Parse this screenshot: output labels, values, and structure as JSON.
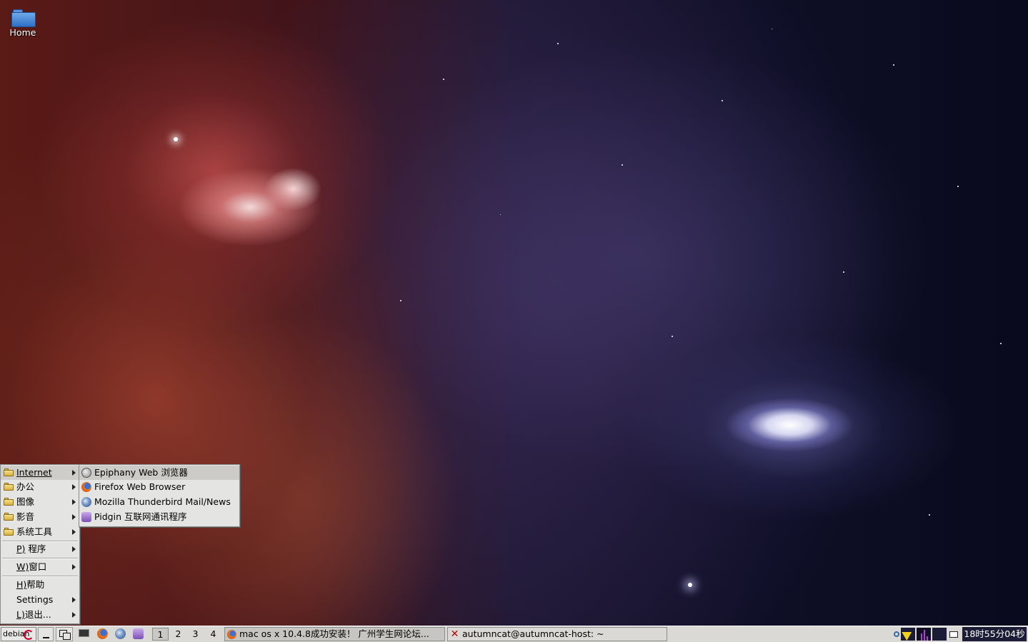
{
  "desktop": {
    "home_label": "Home"
  },
  "main_menu": {
    "items": [
      {
        "label": "Internet",
        "icon": "folder-icon",
        "submenu": true
      },
      {
        "label": "办公",
        "icon": "folder-icon",
        "submenu": true
      },
      {
        "label": "图像",
        "icon": "folder-icon",
        "submenu": true
      },
      {
        "label": "影音",
        "icon": "folder-icon",
        "submenu": true
      },
      {
        "label": "系统工具",
        "icon": "folder-icon",
        "submenu": true
      },
      {
        "prefix": "P)",
        "label": " 程序",
        "submenu": true
      },
      {
        "prefix": "W)",
        "label": "窗口",
        "submenu": true
      },
      {
        "prefix": "H)",
        "label": "帮助",
        "submenu": false
      },
      {
        "label": "Settings",
        "submenu": true
      },
      {
        "prefix": "L)",
        "label": "退出...",
        "submenu": true
      }
    ]
  },
  "internet_menu": {
    "items": [
      {
        "label": "Epiphany Web 浏览器",
        "icon": "epiphany-icon"
      },
      {
        "label": "Firefox Web Browser",
        "icon": "firefox-icon"
      },
      {
        "label": "Mozilla Thunderbird Mail/News",
        "icon": "thunderbird-icon"
      },
      {
        "label": "Pidgin 互联网通讯程序",
        "icon": "pidgin-icon"
      }
    ]
  },
  "taskbar": {
    "start_label": "debian",
    "workspaces": [
      "1",
      "2",
      "3",
      "4"
    ],
    "active_workspace": "1",
    "tasks": [
      {
        "label": "mac os x 10.4.8成功安装！ 广州学生网论坛...",
        "icon": "firefox-icon",
        "active": true
      },
      {
        "label": "autumncat@autumncat-host: ~",
        "icon": "x-terminal-icon",
        "active": false
      }
    ],
    "clock": "18时55分04秒"
  },
  "colors": {
    "menu_bg": "#e4e4e2",
    "taskbar_bg": "#dad9d6",
    "clock_bg": "#1c1c36"
  }
}
